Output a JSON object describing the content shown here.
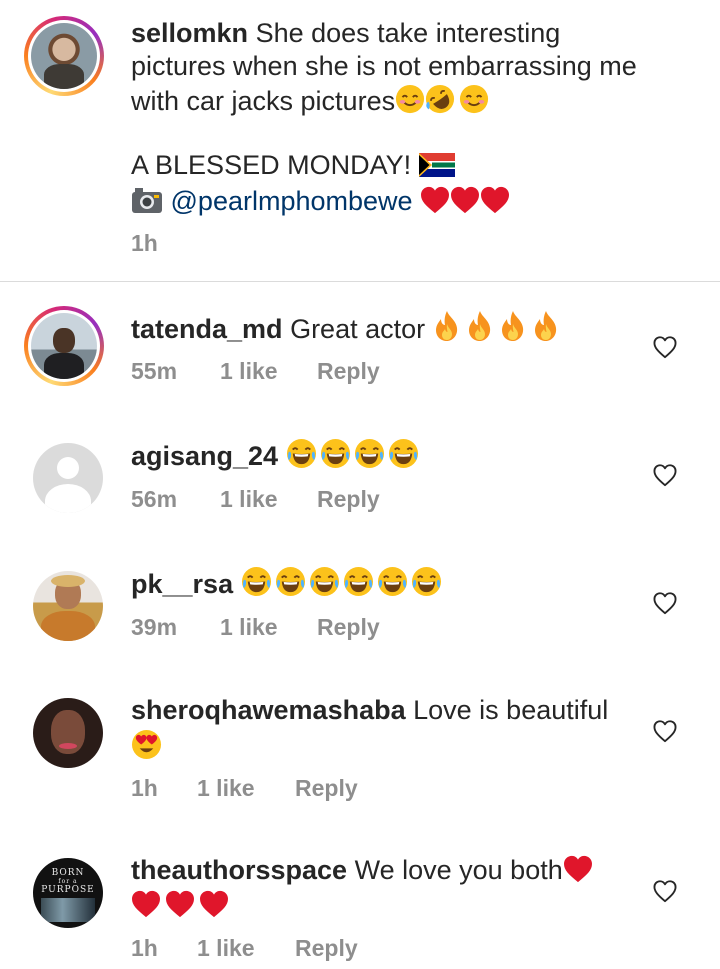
{
  "caption": {
    "username": "sellomkn",
    "line1_text": "She does take interesting",
    "line2": "pictures when she is not embarrassing me",
    "line3": "with car jacks pictures",
    "line4": "A BLESSED MONDAY!",
    "mention": "@pearlmphombewe",
    "time": "1h"
  },
  "comments": [
    {
      "username": "tatenda_md",
      "text": "Great actor",
      "time": "55m",
      "likes": "1 like",
      "reply": "Reply"
    },
    {
      "username": "agisang_24",
      "text": "",
      "time": "56m",
      "likes": "1 like",
      "reply": "Reply"
    },
    {
      "username": "pk__rsa",
      "text": "",
      "time": "39m",
      "likes": "1 like",
      "reply": "Reply"
    },
    {
      "username": "sheroqhawemashaba",
      "text": "Love is beautiful",
      "time": "1h",
      "likes": "1 like",
      "reply": "Reply"
    },
    {
      "username": "theauthorsspace",
      "text": "We love you both",
      "time": "1h",
      "likes": "1 like",
      "reply": "Reply"
    }
  ],
  "avatar_text": {
    "line1": "BORN",
    "line2": "for a",
    "line3": "PURPOSE"
  },
  "icons": {
    "like": "heart-outline-icon",
    "camera": "camera-icon",
    "flag": "south-africa-flag-icon"
  },
  "colors": {
    "text": "#262626",
    "meta": "#8e8e8e",
    "mention": "#003569",
    "heart_red": "#e0162b"
  }
}
